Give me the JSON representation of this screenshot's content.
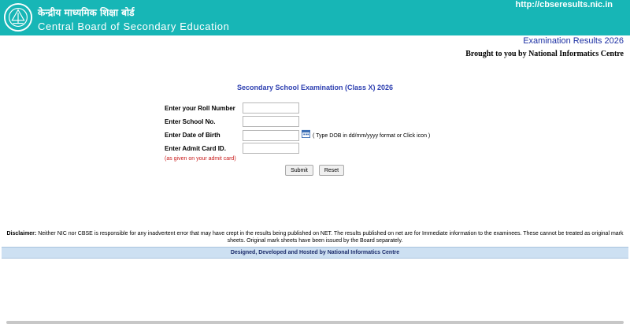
{
  "header": {
    "hindi_title": "केन्द्रीय माध्यमिक शिक्षा बोर्ड",
    "english_title": "Central Board of Secondary Education",
    "url": "http://cbseresults.nic.in",
    "bg_color": "#17b6b6"
  },
  "subheader": {
    "exam_results": "Examination Results 2026",
    "brought_by": "Brought to you by National Informatics Centre"
  },
  "form": {
    "title": "Secondary School Examination (Class X) 2026",
    "roll_label": "Enter your Roll Number",
    "school_label": "Enter School No.",
    "dob_label": "Enter Date of Birth",
    "dob_hint": "( Type DOB in dd/mm/yyyy format or Click icon )",
    "admit_label": "Enter Admit Card ID.",
    "admit_note": "(as given on your admit card)",
    "submit_label": "Submit",
    "reset_label": "Reset",
    "calendar_icon": "calendar-icon"
  },
  "disclaimer": {
    "heading": "Disclaimer:",
    "text": " Neither NIC nor CBSE is responsible for any inadvertent error that may have crept in the results being published on NET. The results published on net are for Immediate information to the examinees. These cannot be treated as original mark sheets. Original mark sheets have been issued by the Board separately."
  },
  "footer": {
    "text": "Designed, Developed and Hosted by National Informatics Centre"
  }
}
